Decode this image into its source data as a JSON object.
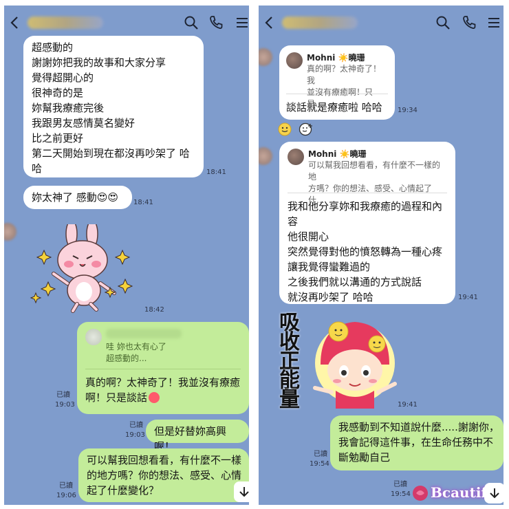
{
  "left": {
    "header": {
      "back_icon": "chevron-left-icon",
      "icons": [
        "search-icon",
        "phone-icon",
        "menu-icon"
      ]
    },
    "msg1": {
      "lines": [
        "超感動的",
        "謝謝妳把我的故事和大家分享",
        "覺得超開心的",
        "很神奇的是",
        "妳幫我療癒完後",
        "我跟男友感情莫名變好",
        "比之前更好",
        "第二天開始到現在都沒再吵架了 哈",
        "哈"
      ],
      "time": "18:41"
    },
    "msg2": {
      "text": "妳太神了 感動😍😍",
      "time": "18:41"
    },
    "sticker1": {
      "name": "pink-rabbit-sticker",
      "time": "18:42"
    },
    "msg3": {
      "quote_text_1": "哇 妳也太有心了",
      "quote_text_2": "超感動的...",
      "lines": [
        "真的啊？太神奇了！我並沒有療癒",
        "啊！只是談話"
      ],
      "read": "已讀",
      "time": "19:03"
    },
    "msg4": {
      "text": "但是好替妳高興喔！",
      "read": "已讀",
      "time": "19:03"
    },
    "msg5": {
      "lines": [
        "可以幫我回想看看，有什麼不一樣",
        "的地方嗎？你的想法、感受、心情",
        "起了什麼變化？"
      ],
      "read": "已讀",
      "time": "19:06"
    }
  },
  "right": {
    "header": {
      "back_icon": "chevron-left-icon",
      "icons": [
        "search-icon",
        "phone-icon",
        "menu-icon"
      ]
    },
    "msg1": {
      "quote_name": "Mohni ☀️曉珊",
      "quote_text_1": "真的啊？太神奇了！我",
      "quote_text_2": "並沒有療癒啊！只是...",
      "text": "談話就是療癒啦 哈哈",
      "time": "19:34"
    },
    "msg2": {
      "quote_name": "Mohni ☀️曉珊",
      "quote_text_1": "可以幫我回想看看，有什麼不一樣的地",
      "quote_text_2": "方嗎？你的想法、感受、心情起了什...",
      "lines": [
        "我和他分享妳和我療癒的過程和內",
        "容",
        "他很開心",
        "突然覺得對他的憤怒轉為一種心疼",
        "讓我覺得蠻難過的",
        "之後我們就以溝通的方式說話",
        "就沒再吵架了 哈哈"
      ],
      "time": "19:41"
    },
    "sticker2": {
      "text": [
        "吸",
        "收",
        "正",
        "能",
        "量"
      ],
      "time": "19:41"
    },
    "msg3": {
      "lines": [
        "我感動到不知道說什麼.....謝謝你，",
        "我會記得這件事，在生命任務中不",
        "斷勉勵自己"
      ],
      "read": "已讀",
      "time": "19:54"
    },
    "read2": {
      "read": "已讀",
      "time": "19:54"
    },
    "watermark": "Bcautife"
  }
}
